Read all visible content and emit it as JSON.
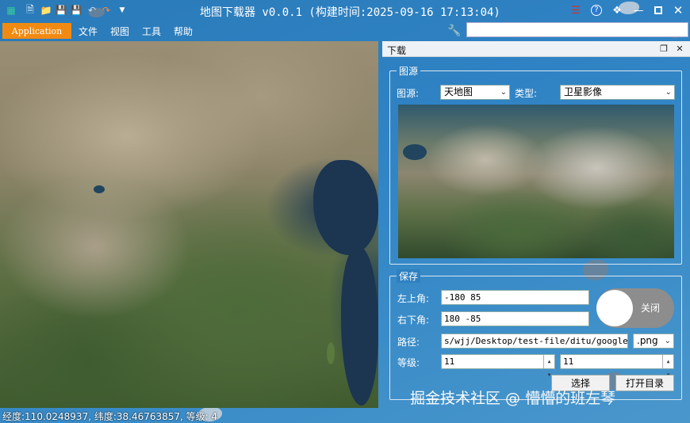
{
  "titlebar": {
    "title": "地图下载器 v0.0.1 (构建时间:2025-09-16 17:13:04)",
    "quick_access": [
      "app-icon",
      "new-file-icon",
      "open-folder-icon",
      "save-icon",
      "save-as-icon",
      "undo-icon",
      "redo-icon",
      "dropdown-icon"
    ],
    "right_icons": [
      "menu-icon",
      "help-icon",
      "shirt-icon",
      "minimize-icon",
      "maximize-icon",
      "close-icon"
    ]
  },
  "menubar": {
    "app_button": "Application",
    "items": [
      "文件",
      "视图",
      "工具",
      "帮助"
    ],
    "search_value": ""
  },
  "panel": {
    "title": "下载",
    "source_group": {
      "legend": "图源",
      "source_label": "图源:",
      "source_value": "天地图",
      "type_label": "类型:",
      "type_value": "卫星影像"
    },
    "save_group": {
      "legend": "保存",
      "top_left_label": "左上角:",
      "top_left_value": "-180 85",
      "bottom_right_label": "右下角:",
      "bottom_right_value": "180 -85",
      "path_label": "路径:",
      "path_value": "s/wjj/Desktop/test-file/ditu/googlemap",
      "format_value": ".png",
      "level_label": "等级:",
      "level_from": "11",
      "level_to": "11",
      "select_button": "选择",
      "open_dir_button": "打开目录",
      "toggle_label": "关闭",
      "toggle_on": false
    }
  },
  "watermark": "掘金技术社区 @ 懵懵的班左琴",
  "status": {
    "text": "经度:110.0248937, 纬度:38.46763857, 等级: 4"
  },
  "colors": {
    "app_button": "#f18a12",
    "window_bg": "#2f83c4"
  }
}
